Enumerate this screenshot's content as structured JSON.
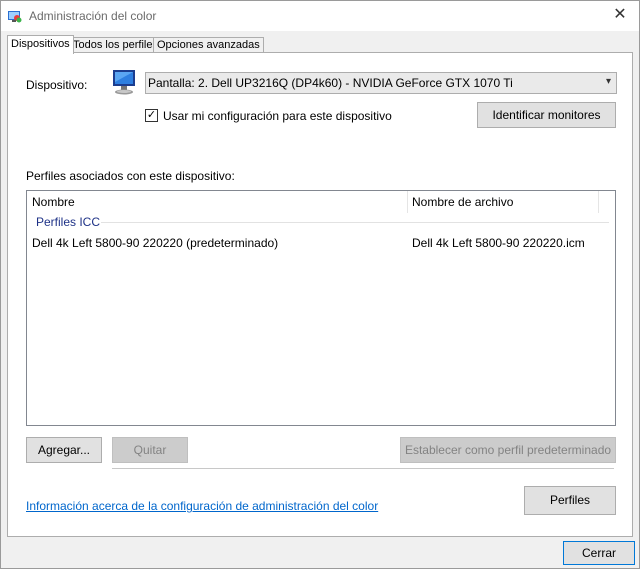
{
  "window": {
    "title": "Administración del color",
    "close_glyph": "✕",
    "icon": "color-management-icon"
  },
  "tabs": [
    {
      "label": "Dispositivos",
      "active": true
    },
    {
      "label": "Todos los perfiles",
      "active": false
    },
    {
      "label": "Opciones avanzadas",
      "active": false
    }
  ],
  "device": {
    "label": "Dispositivo:",
    "icon": "monitor-icon",
    "selected": "Pantalla: 2. Dell UP3216Q (DP4k60) - NVIDIA GeForce GTX 1070 Ti",
    "use_my_settings_label": "Usar mi configuración para este dispositivo",
    "use_my_settings_checked": true,
    "check_glyph": "✓",
    "identify_button": "Identificar monitores"
  },
  "profiles": {
    "label": "Perfiles asociados con este dispositivo:",
    "columns": [
      "Nombre",
      "Nombre de archivo"
    ],
    "group": "Perfiles ICC",
    "rows": [
      {
        "name": "Dell 4k Left 5800-90 220220 (predeterminado)",
        "file": "Dell 4k Left 5800-90 220220.icm"
      }
    ]
  },
  "buttons": {
    "add": "Agregar...",
    "remove": "Quitar",
    "set_default": "Establecer como perfil predeterminado",
    "profiles": "Perfiles",
    "close": "Cerrar"
  },
  "link": "Información acerca de la configuración de administración del color",
  "colors": {
    "link": "#0066cc",
    "group_header": "#1e3287"
  }
}
